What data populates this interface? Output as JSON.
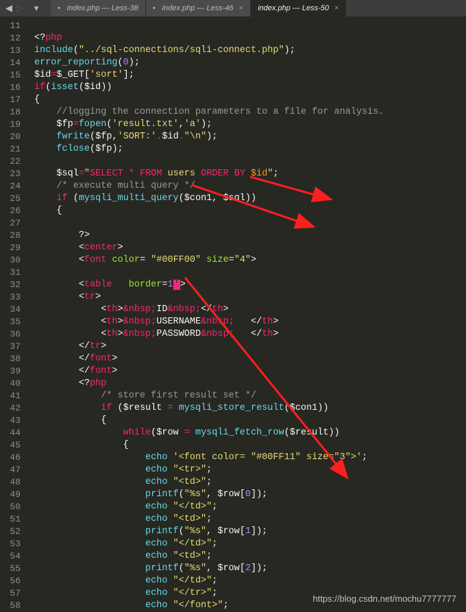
{
  "nav": {
    "back": "◀",
    "fwd": "▷",
    "menu": "▾"
  },
  "tabs": [
    {
      "label": "index.php — Less-38",
      "active": false,
      "modified": true,
      "closeable": false
    },
    {
      "label": "index.php — Less-46",
      "active": false,
      "modified": true,
      "closeable": true
    },
    {
      "label": "index.php — Less-50",
      "active": true,
      "modified": false,
      "closeable": true
    }
  ],
  "first_line_number": 11,
  "code_lines": [
    "",
    "<span class='t-def'>&lt;?</span><span class='t-kw'>php</span>",
    "<span class='t-cy'>include</span><span class='t-def'>(</span><span class='t-str'>\"../sql-connections/sqli-connect.php\"</span><span class='t-def'>);</span>",
    "<span class='t-cy'>error_reporting</span><span class='t-def'>(</span><span class='t-num'>0</span><span class='t-def'>);</span>",
    "<span class='t-var'>$id</span><span class='t-kw'>=</span><span class='t-var'>$_GET</span><span class='t-def'>[</span><span class='t-str'>'sort'</span><span class='t-def'>];</span>",
    "<span class='t-kw'>if</span><span class='t-def'>(</span><span class='t-cy'>isset</span><span class='t-def'>(</span><span class='t-var'>$id</span><span class='t-def'>))</span>",
    "<span class='t-def'>{</span>",
    "    <span class='t-cmt'>//logging the connection parameters to a file for analysis.</span>",
    "    <span class='t-var'>$fp</span><span class='t-kw'>=</span><span class='t-cy'>fopen</span><span class='t-def'>(</span><span class='t-str'>'result.txt'</span><span class='t-def'>,</span><span class='t-str'>'a'</span><span class='t-def'>);</span>",
    "    <span class='t-cy'>fwrite</span><span class='t-def'>(</span><span class='t-var'>$fp</span><span class='t-def'>,</span><span class='t-str'>'SORT:'</span><span class='t-kw'>.</span><span class='t-var'>$id</span><span class='t-kw'>.</span><span class='t-str'>\"\\n\"</span><span class='t-def'>);</span>",
    "    <span class='t-cy'>fclose</span><span class='t-def'>(</span><span class='t-var'>$fp</span><span class='t-def'>);</span>",
    "",
    "    <span class='t-var'>$sql</span><span class='t-kw'>=</span><span class='t-str'>\"</span><span class='t-kw'>SELECT</span><span class='t-str'> </span><span class='t-kw'>*</span><span class='t-str'> </span><span class='t-kw'>FROM</span><span class='t-str'> users </span><span class='t-kw'>ORDER BY</span><span class='t-str'> </span><span class='t-id'>$id</span><span class='t-str'>\"</span><span class='t-def'>;</span>",
    "    <span class='t-cmt'>/* execute multi query */</span>",
    "    <span class='t-kw'>if</span> <span class='t-def'>(</span><span class='t-cy'>mysqli_multi_query</span><span class='t-def'>(</span><span class='t-var'>$con1</span><span class='t-def'>, </span><span class='t-var'>$sql</span><span class='t-def'>))</span>",
    "    <span class='t-def'>{</span>",
    "",
    "        <span class='t-def'>?&gt;</span>",
    "        <span class='t-pun'>&lt;</span><span class='t-tag'>center</span><span class='t-pun'>&gt;</span>",
    "        <span class='t-pun'>&lt;</span><span class='t-tag'>font</span> <span class='t-attr'>color</span><span class='t-def'>=</span> <span class='t-str'>\"#00FF00\"</span> <span class='t-attr'>size</span><span class='t-def'>=</span><span class='t-str'>\"4\"</span><span class='t-pun'>&gt;</span>",
    "",
    "        <span class='t-pun'>&lt;</span><span class='t-tag'>table</span>   <span class='t-attr'>border</span><span class='t-def'>=</span><span class='t-num'>1</span><span class='cursor-block'>'</span><span class='t-pun'>&gt;</span>",
    "        <span class='t-pun'>&lt;</span><span class='t-tag'>tr</span><span class='t-pun'>&gt;</span>",
    "            <span class='t-pun'>&lt;</span><span class='t-tag'>th</span><span class='t-pun'>&gt;</span><span class='t-kw'>&amp;nbsp;</span><span class='t-def'>ID</span><span class='t-kw'>&amp;nbsp;</span><span class='t-pun'>&lt;/</span><span class='t-tag'>th</span><span class='t-pun'>&gt;</span>",
    "            <span class='t-pun'>&lt;</span><span class='t-tag'>th</span><span class='t-pun'>&gt;</span><span class='t-kw'>&amp;nbsp;</span><span class='t-def'>USERNAME</span><span class='t-kw'>&amp;nbsp;</span>   <span class='t-pun'>&lt;/</span><span class='t-tag'>th</span><span class='t-pun'>&gt;</span>",
    "            <span class='t-pun'>&lt;</span><span class='t-tag'>th</span><span class='t-pun'>&gt;</span><span class='t-kw'>&amp;nbsp;</span><span class='t-def'>PASSWORD</span><span class='t-kw'>&amp;nbsp;</span>   <span class='t-pun'>&lt;/</span><span class='t-tag'>th</span><span class='t-pun'>&gt;</span>",
    "        <span class='t-pun'>&lt;/</span><span class='t-tag'>tr</span><span class='t-pun'>&gt;</span>",
    "        <span class='t-pun'>&lt;/</span><span class='t-tag'>font</span><span class='t-pun'>&gt;</span>",
    "        <span class='t-pun'>&lt;/</span><span class='t-tag'>font</span><span class='t-pun'>&gt;</span>",
    "        <span class='t-def'>&lt;?</span><span class='t-kw'>php</span>",
    "            <span class='t-cmt'>/* store first result set */</span>",
    "            <span class='t-kw'>if</span> <span class='t-def'>(</span><span class='t-var'>$result</span> <span class='t-kw'>=</span> <span class='t-cy'>mysqli_store_result</span><span class='t-def'>(</span><span class='t-var'>$con1</span><span class='t-def'>))</span>",
    "            <span class='t-def'>{</span>",
    "                <span class='t-kw'>while</span><span class='t-def'>(</span><span class='t-var'>$row</span> <span class='t-kw'>=</span> <span class='t-cy'>mysqli_fetch_row</span><span class='t-def'>(</span><span class='t-var'>$result</span><span class='t-def'>))</span>",
    "                <span class='t-def'>{</span>",
    "                    <span class='t-cy'>echo</span> <span class='t-str'>'&lt;font color= \"#00FF11\" size=\"3\"&gt;'</span><span class='t-def'>;</span>",
    "                    <span class='t-cy'>echo</span> <span class='t-str'>\"&lt;tr&gt;\"</span><span class='t-def'>;</span>",
    "                    <span class='t-cy'>echo</span> <span class='t-str'>\"&lt;td&gt;\"</span><span class='t-def'>;</span>",
    "                    <span class='t-cy'>printf</span><span class='t-def'>(</span><span class='t-str'>\"%s\"</span><span class='t-def'>, </span><span class='t-var'>$row</span><span class='t-def'>[</span><span class='t-num'>0</span><span class='t-def'>]);</span>",
    "                    <span class='t-cy'>echo</span> <span class='t-str'>\"&lt;/td&gt;\"</span><span class='t-def'>;</span>",
    "                    <span class='t-cy'>echo</span> <span class='t-str'>\"&lt;td&gt;\"</span><span class='t-def'>;</span>",
    "                    <span class='t-cy'>printf</span><span class='t-def'>(</span><span class='t-str'>\"%s\"</span><span class='t-def'>, </span><span class='t-var'>$row</span><span class='t-def'>[</span><span class='t-num'>1</span><span class='t-def'>]);</span>",
    "                    <span class='t-cy'>echo</span> <span class='t-str'>\"&lt;/td&gt;\"</span><span class='t-def'>;</span>",
    "                    <span class='t-cy'>echo</span> <span class='t-str'>\"&lt;td&gt;\"</span><span class='t-def'>;</span>",
    "                    <span class='t-cy'>printf</span><span class='t-def'>(</span><span class='t-str'>\"%s\"</span><span class='t-def'>, </span><span class='t-var'>$row</span><span class='t-def'>[</span><span class='t-num'>2</span><span class='t-def'>]);</span>",
    "                    <span class='t-cy'>echo</span> <span class='t-str'>\"&lt;/td&gt;\"</span><span class='t-def'>;</span>",
    "                    <span class='t-cy'>echo</span> <span class='t-str'>\"&lt;/tr&gt;\"</span><span class='t-def'>;</span>",
    "                    <span class='t-cy'>echo</span> <span class='t-str'>\"&lt;/font&gt;\"</span><span class='t-def'>;</span>"
  ],
  "watermark": "https://blog.csdn.net/mochu7777777"
}
